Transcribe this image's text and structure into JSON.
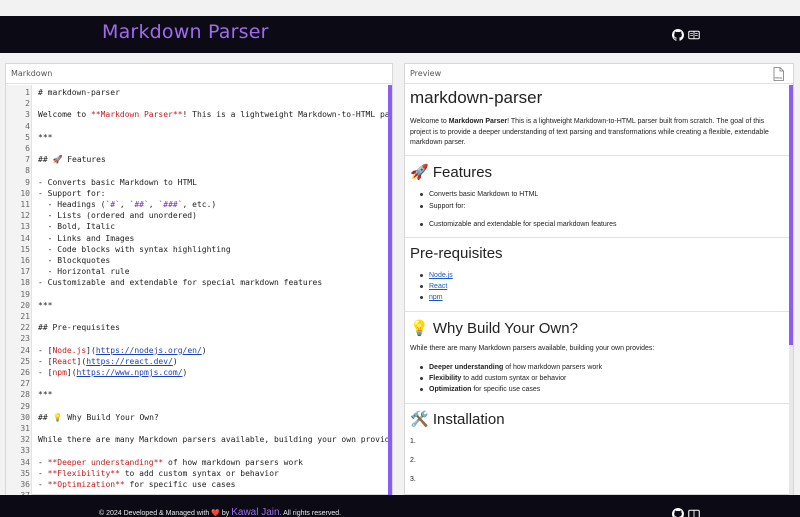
{
  "app": {
    "title": "Markdown Parser",
    "accent": "#9f6cf0",
    "header_bg": "#0c0a14"
  },
  "header": {
    "icons": [
      "github-icon",
      "book-icon"
    ]
  },
  "editor": {
    "label": "Markdown",
    "lines": [
      {
        "n": "1",
        "t": "# markdown-parser"
      },
      {
        "n": "2",
        "t": ""
      },
      {
        "n": "3",
        "t": "Welcome to **Markdown Parser**! This is a lightweight Markdown-to-HTML parser bu"
      },
      {
        "n": "4",
        "t": ""
      },
      {
        "n": "5",
        "t": "***"
      },
      {
        "n": "6",
        "t": ""
      },
      {
        "n": "7",
        "t": "## 🚀 Features"
      },
      {
        "n": "8",
        "t": ""
      },
      {
        "n": "9",
        "t": "- Converts basic Markdown to HTML"
      },
      {
        "n": "10",
        "t": "- Support for:"
      },
      {
        "n": "11",
        "t": "  - Headings (`#`, `##`, `###`, etc.)"
      },
      {
        "n": "12",
        "t": "  - Lists (ordered and unordered)"
      },
      {
        "n": "13",
        "t": "  - Bold, Italic"
      },
      {
        "n": "14",
        "t": "  - Links and Images"
      },
      {
        "n": "15",
        "t": "  - Code blocks with syntax highlighting"
      },
      {
        "n": "16",
        "t": "  - Blockquotes"
      },
      {
        "n": "17",
        "t": "  - Horizontal rule"
      },
      {
        "n": "18",
        "t": "- Customizable and extendable for special markdown features"
      },
      {
        "n": "19",
        "t": ""
      },
      {
        "n": "20",
        "t": "***"
      },
      {
        "n": "21",
        "t": ""
      },
      {
        "n": "22",
        "t": "## Pre-requisites"
      },
      {
        "n": "23",
        "t": ""
      },
      {
        "n": "24",
        "t": "- [Node.js](https://nodejs.org/en/)"
      },
      {
        "n": "25",
        "t": "- [React](https://react.dev/)"
      },
      {
        "n": "26",
        "t": "- [npm](https://www.npmjs.com/)"
      },
      {
        "n": "27",
        "t": ""
      },
      {
        "n": "28",
        "t": "***"
      },
      {
        "n": "29",
        "t": ""
      },
      {
        "n": "30",
        "t": "## 💡 Why Build Your Own?"
      },
      {
        "n": "31",
        "t": ""
      },
      {
        "n": "32",
        "t": "While there are many Markdown parsers available, building your own provides:"
      },
      {
        "n": "33",
        "t": ""
      },
      {
        "n": "34",
        "t": "- **Deeper understanding** of how markdown parsers work"
      },
      {
        "n": "35",
        "t": "- **Flexibility** to add custom syntax or behavior"
      },
      {
        "n": "36",
        "t": "- **Optimization** for specific use cases"
      },
      {
        "n": "37",
        "t": ""
      }
    ]
  },
  "preview": {
    "label": "Preview",
    "export_icon": "html-file-icon",
    "export_label": "HTML",
    "h1": "markdown-parser",
    "intro_pre": "Welcome to ",
    "intro_bold": "Markdown Parser",
    "intro_post": "! This is a lightweight Markdown-to-HTML parser built from scratch. The goal of this project is to provide a deeper understanding of text parsing and transformations while creating a flexible, extendable markdown parser.",
    "features_title": "🚀 Features",
    "features": [
      "Converts basic Markdown to HTML",
      "Support for:",
      "Customizable and extendable for special markdown features"
    ],
    "prereq_title": "Pre-requisites",
    "prereqs": [
      "Node.js",
      "React",
      "npm"
    ],
    "why_title": "💡 Why Build Your Own?",
    "why_text": "While there are many Markdown parsers available, building your own provides:",
    "why_items": [
      {
        "bold": "Deeper understanding",
        "rest": " of how markdown parsers work"
      },
      {
        "bold": "Flexibility",
        "rest": " to add custom syntax or behavior"
      },
      {
        "bold": "Optimization",
        "rest": " for specific use cases"
      }
    ],
    "install_title": "🛠️ Installation",
    "install_steps": [
      "1.",
      "2.",
      "3."
    ]
  },
  "footer": {
    "prefix": "© 2024 Developed & Managed with",
    "heart": "❤️",
    "by": "by",
    "author": "Kawal Jain",
    "suffix": ". All rights reserved."
  }
}
